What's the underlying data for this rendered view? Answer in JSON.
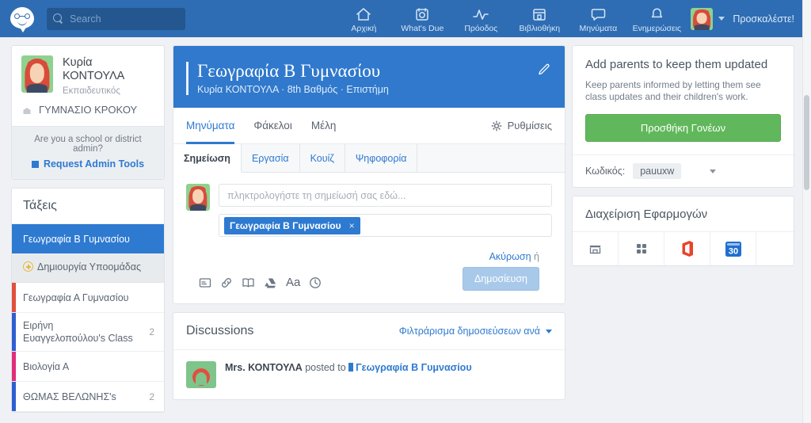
{
  "topnav": {
    "logo_name": "edmodo-logo",
    "search": {
      "placeholder": "Search",
      "value": ""
    },
    "items": [
      {
        "label": "Αρχική",
        "icon": "home-icon"
      },
      {
        "label": "What's Due",
        "icon": "calendar-check-icon"
      },
      {
        "label": "Πρόοδος",
        "icon": "progress-pulse-icon"
      },
      {
        "label": "Βιβλιοθήκη",
        "icon": "library-icon"
      },
      {
        "label": "Μηνύματα",
        "icon": "chat-bubble-icon"
      },
      {
        "label": "Ενημερώσεις",
        "icon": "bell-icon"
      }
    ],
    "invite_label": "Προσκαλέστε!",
    "accent_color": "#2e6db4"
  },
  "sidebar": {
    "profile": {
      "name_line1": "Κυρία",
      "name_line2": "ΚΟΝΤΟΥΛΑ",
      "role": "Εκπαιδευτικός",
      "school": "ΓΥΜΝΑΣΙΟ ΚΡΟΚΟΥ"
    },
    "admin": {
      "question": "Are you a school or district admin?",
      "link": "Request Admin Tools"
    },
    "classes_title": "Τάξεις",
    "classes": [
      {
        "label": "Γεωγραφία Β Γυμνασίου",
        "count": "",
        "bar": "",
        "active": true
      },
      {
        "label": "Γεωγραφία Α Γυμνασίου",
        "count": "",
        "bar": "#e0503e",
        "active": false
      },
      {
        "label": "Ειρήνη Ευαγγελοπούλου's Class",
        "count": "2",
        "bar": "#2e5fd1",
        "active": false
      },
      {
        "label": "Βιολογία Α",
        "count": "",
        "bar": "#e02d7a",
        "active": false
      },
      {
        "label": "ΘΩΜΑΣ ΒΕΛΩΝΗΣ's",
        "count": "2",
        "bar": "#2e5fd1",
        "active": false
      }
    ],
    "subgroup_label": "Δημιουργία Υποομάδας"
  },
  "main": {
    "class_title": "Γεωγραφία Β Γυμνασίου",
    "class_subtitle": "Κυρία ΚΟΝΤΟΥΛΑ · 8th Βαθμός · Επιστήμη",
    "edit_icon": "pencil-icon",
    "tabs": [
      {
        "label": "Μηνύματα",
        "active": true
      },
      {
        "label": "Φάκελοι",
        "active": false
      },
      {
        "label": "Μέλη",
        "active": false
      }
    ],
    "settings_label": "Ρυθμίσεις",
    "composer": {
      "tabs": [
        {
          "label": "Σημείωση",
          "active": true
        },
        {
          "label": "Εργασία",
          "active": false
        },
        {
          "label": "Κουίζ",
          "active": false
        },
        {
          "label": "Ψηφοφορία",
          "active": false
        }
      ],
      "placeholder": "πληκτρολογήστε τη σημείωσή σας εδώ...",
      "value": "",
      "tag_chip": "Γεωγραφία Β Γυμνασίου",
      "chip_remove": "×",
      "tools": [
        "attachment-icon",
        "link-icon",
        "library-book-icon",
        "google-drive-icon",
        "text-format-icon",
        "schedule-clock-icon"
      ],
      "cancel_label": "Ακύρωση",
      "or_label": "ή",
      "post_label": "Δημοσίευση"
    },
    "discussions": {
      "title": "Discussions",
      "filter_label": "Φιλτράρισμα δημοσιεύσεων ανά",
      "posts": [
        {
          "author": "Mrs. ΚΟΝΤΟΥΛΑ",
          "action": "posted to",
          "target": "Γεωγραφία Β Γυμνασίου"
        }
      ]
    }
  },
  "right": {
    "parents": {
      "title": "Add parents to keep them updated",
      "desc": "Keep parents informed by letting them see class updates and their children's work.",
      "button": "Προσθήκη Γονέων",
      "button_color": "#61b85c",
      "code_label": "Κωδικός:",
      "code_value": "pauuxw"
    },
    "apps": {
      "title": "Διαχείριση Εφαρμογών",
      "items": [
        "app-store-icon",
        "app-grid-icon",
        "office-icon",
        "calendar-30-icon"
      ]
    }
  }
}
